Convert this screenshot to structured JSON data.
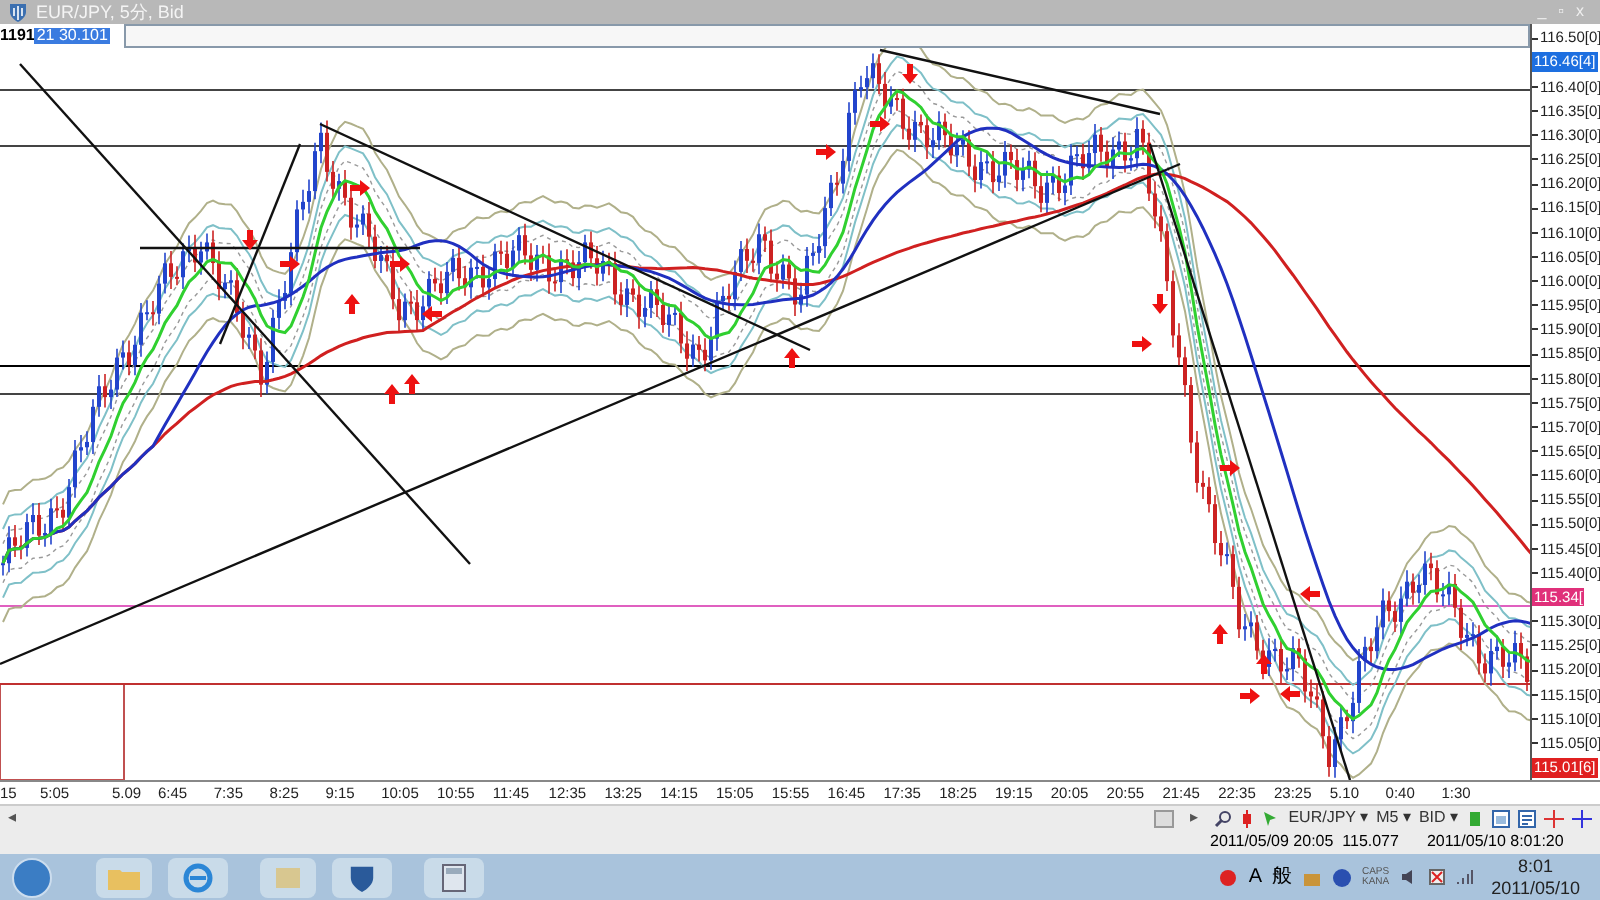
{
  "window": {
    "title": "EUR/JPY, 5分, Bid",
    "controls": [
      "_",
      "▫",
      "x"
    ]
  },
  "chart": {
    "corner_label": "1191",
    "corner_value": "21 30.101"
  },
  "price_axis": [
    {
      "kind": "tick",
      "text": "116.50[0]"
    },
    {
      "kind": "price",
      "text": "116.46[4]",
      "color": "#1d6fe0"
    },
    {
      "kind": "tick",
      "text": "116.40[0]"
    },
    {
      "kind": "tick",
      "text": "116.35[0]"
    },
    {
      "kind": "tick",
      "text": "116.30[0]"
    },
    {
      "kind": "tick",
      "text": "116.25[0]"
    },
    {
      "kind": "tick",
      "text": "116.20[0]"
    },
    {
      "kind": "tick",
      "text": "116.15[0]"
    },
    {
      "kind": "tick",
      "text": "116.10[0]"
    },
    {
      "kind": "tick",
      "text": "116.05[0]"
    },
    {
      "kind": "tick",
      "text": "116.00[0]"
    },
    {
      "kind": "tick",
      "text": "115.95[0]"
    },
    {
      "kind": "tick",
      "text": "115.90[0]"
    },
    {
      "kind": "tick",
      "text": "115.85[0]"
    },
    {
      "kind": "tick",
      "text": "115.80[0]"
    },
    {
      "kind": "tick",
      "text": "115.75[0]"
    },
    {
      "kind": "tick",
      "text": "115.70[0]"
    },
    {
      "kind": "tick",
      "text": "115.65[0]"
    },
    {
      "kind": "tick",
      "text": "115.60[0]"
    },
    {
      "kind": "tick",
      "text": "115.55[0]"
    },
    {
      "kind": "tick",
      "text": "115.50[0]"
    },
    {
      "kind": "tick",
      "text": "115.45[0]"
    },
    {
      "kind": "tick",
      "text": "115.40[0]"
    },
    {
      "kind": "price",
      "text": "115.34[",
      "color": "#e0307a"
    },
    {
      "kind": "tick",
      "text": "115.30[0]"
    },
    {
      "kind": "tick",
      "text": "115.25[0]"
    },
    {
      "kind": "tick",
      "text": "115.20[0]"
    },
    {
      "kind": "tick",
      "text": "115.15[0]"
    },
    {
      "kind": "tick",
      "text": "115.10[0]"
    },
    {
      "kind": "tick",
      "text": "115.05[0]"
    },
    {
      "kind": "price",
      "text": "115.01[6]",
      "color": "#e02020"
    }
  ],
  "time_axis": [
    "15",
    "5:05",
    "5.09",
    "6:45",
    "7:35",
    "8:25",
    "9:15",
    "10:05",
    "10:55",
    "11:45",
    "12:35",
    "13:25",
    "14:15",
    "15:05",
    "15:55",
    "16:45",
    "17:35",
    "18:25",
    "19:15",
    "20:05",
    "20:55",
    "21:45",
    "22:35",
    "23:25",
    "5.10",
    "0:40",
    "1:30"
  ],
  "toolbar": {
    "scroll_left": "◂",
    "scroll_right": "▸",
    "dropdowns": [
      "EUR/JPY ▾",
      "M5 ▾",
      "BID ▾"
    ]
  },
  "status_bar": {
    "bar_info": "2011/05/09 20:05  115.077",
    "time": "2011/05/10 8:01:20"
  },
  "taskbar": {
    "ime": [
      "A",
      "般"
    ],
    "keys": [
      "CAPS",
      "KANA"
    ],
    "clock_time": "8:01",
    "clock_date": "2011/05/10"
  }
}
